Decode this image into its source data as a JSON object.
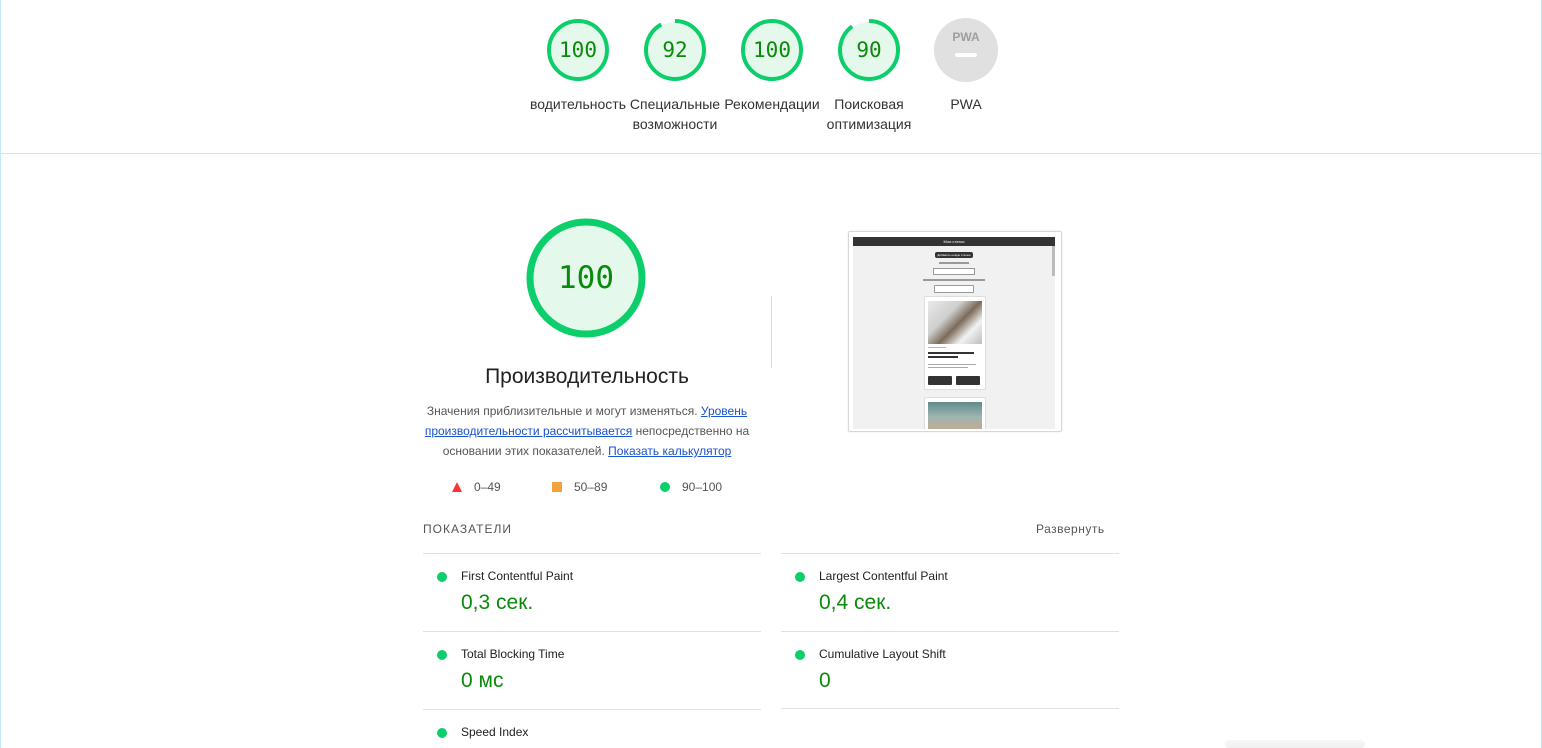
{
  "categories": [
    {
      "score": "100",
      "label": "Производительность",
      "fraction": 1.0,
      "color": "#0cce6b"
    },
    {
      "score": "92",
      "label": "Специальные возможности",
      "fraction": 0.92,
      "color": "#0cce6b"
    },
    {
      "score": "100",
      "label": "Рекомендации",
      "fraction": 1.0,
      "color": "#0cce6b"
    },
    {
      "score": "90",
      "label": "Поисковая оптимизация",
      "fraction": 0.9,
      "color": "#0cce6b"
    },
    {
      "score": "",
      "label": "PWA",
      "badge": "PWA",
      "fraction": 0,
      "color": "#9e9e9e"
    }
  ],
  "performance": {
    "score": "100",
    "fraction": 1.0,
    "title": "Производительность",
    "desc_text_1": "Значения приблизительные и могут изменяться. ",
    "desc_link_1": "Уровень производительности рассчитывается",
    "desc_text_2": " непосредственно на основании этих показателей. ",
    "desc_link_2": "Показать калькулятор"
  },
  "legend": {
    "fail": "0–49",
    "average": "50–89",
    "pass": "90–100",
    "colors": {
      "fail": "#ff3333",
      "average": "#f4a23b",
      "pass": "#0cce6b"
    }
  },
  "metrics_header": "ПОКАЗАТЕЛИ",
  "expand_label": "Развернуть",
  "metrics": [
    {
      "name": "First Contentful Paint",
      "value": "0,3 сек."
    },
    {
      "name": "Largest Contentful Paint",
      "value": "0,4 сек."
    },
    {
      "name": "Total Blocking Time",
      "value": "0 мс"
    },
    {
      "name": "Cumulative Layout Shift",
      "value": "0"
    },
    {
      "name": "Speed Index",
      "value": ""
    }
  ],
  "thumbnail": {
    "header": "Мои статьи",
    "button": "Добавить новую статью"
  }
}
